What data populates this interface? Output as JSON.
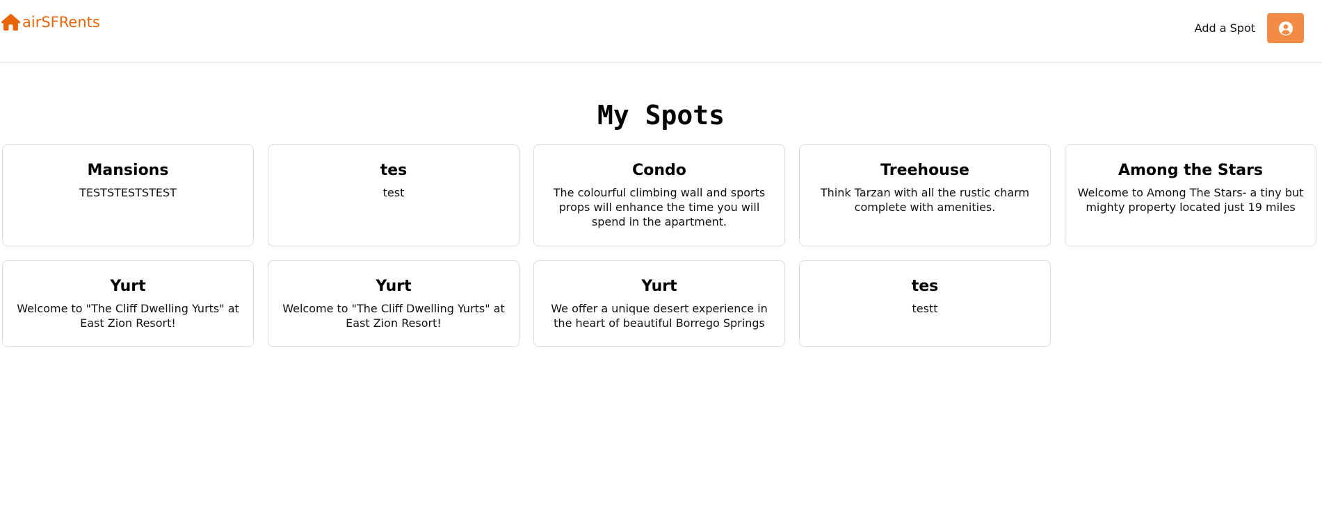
{
  "brand": {
    "name": "airSFRents",
    "color": "#e8650a",
    "icon": "home-icon"
  },
  "nav": {
    "add_spot_label": "Add a Spot",
    "profile_icon": "user-circle-icon",
    "profile_button_color": "#f28b45"
  },
  "page": {
    "title": "My Spots"
  },
  "spots": [
    {
      "title": "Mansions",
      "description": "TESTSTESTSTEST"
    },
    {
      "title": "tes",
      "description": "test"
    },
    {
      "title": "Condo",
      "description": "The colourful climbing wall and sports props will enhance the time you will spend in the apartment."
    },
    {
      "title": "Treehouse",
      "description": "Think Tarzan with all the rustic charm complete with amenities."
    },
    {
      "title": "Among the Stars",
      "description": "Welcome to Among The Stars- a tiny but mighty property located just 19 miles"
    },
    {
      "title": "Yurt",
      "description": "Welcome to \"The Cliff Dwelling Yurts\" at East Zion Resort!"
    },
    {
      "title": "Yurt",
      "description": "Welcome to \"The Cliff Dwelling Yurts\" at East Zion Resort!"
    },
    {
      "title": "Yurt",
      "description": "We offer a unique desert experience in the heart of beautiful Borrego Springs"
    },
    {
      "title": "tes",
      "description": "testt"
    }
  ]
}
